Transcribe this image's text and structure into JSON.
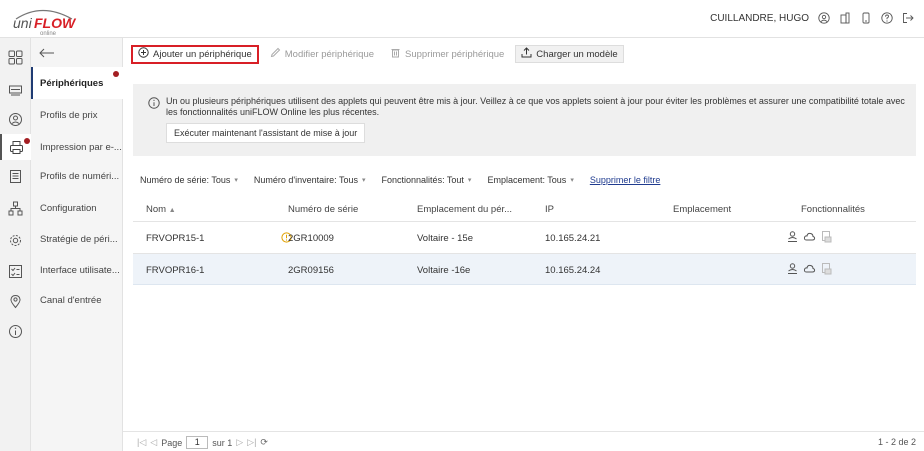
{
  "header": {
    "logo_text": "uniFLOW",
    "logo_sub": "online",
    "user_name": "CUILLANDRE, HUGO"
  },
  "subnav": {
    "items": [
      {
        "label": "Périphériques"
      },
      {
        "label": "Profils de prix"
      },
      {
        "label": "Impression par e-..."
      },
      {
        "label": "Profils de numéri..."
      },
      {
        "label": "Configuration"
      },
      {
        "label": "Stratégie de péri..."
      },
      {
        "label": "Interface utilisate..."
      },
      {
        "label": "Canal d'entrée"
      }
    ]
  },
  "toolbar": {
    "add_label": "Ajouter un périphérique",
    "edit_label": "Modifier périphérique",
    "delete_label": "Supprimer périphérique",
    "load_label": "Charger un modèle"
  },
  "banner": {
    "text": "Un ou plusieurs périphériques utilisent des applets qui peuvent être mis à jour. Veillez à ce que vos applets soient à jour pour éviter les problèmes et assurer une compatibilité totale avec les fonctionnalités uniFLOW Online les plus récentes.",
    "button_label": "Exécuter maintenant l'assistant de mise à jour"
  },
  "filters": {
    "serial": "Numéro de série: Tous",
    "inventory": "Numéro d'inventaire: Tous",
    "features": "Fonctionnalités: Tout",
    "location": "Emplacement: Tous",
    "clear": "Supprimer le filtre"
  },
  "table": {
    "columns": {
      "name": "Nom",
      "serial": "Numéro de série",
      "device_location": "Emplacement du pér...",
      "ip": "IP",
      "location": "Emplacement",
      "features": "Fonctionnalités"
    },
    "rows": [
      {
        "name": "FRVOPR15-1",
        "serial": "2GR10009",
        "device_location": "Voltaire - 15e",
        "ip": "10.165.24.21",
        "location": "",
        "warning": true
      },
      {
        "name": "FRVOPR16-1",
        "serial": "2GR09156",
        "device_location": "Voltaire -16e",
        "ip": "10.165.24.24",
        "location": "",
        "warning": false
      }
    ]
  },
  "pager": {
    "page_label": "Page",
    "page_value": "1",
    "of_label": "sur 1",
    "summary": "1 - 2 de 2"
  },
  "colors": {
    "accent_red": "#d81f26",
    "link_blue": "#1f3b8f",
    "warning": "#e0a000"
  }
}
